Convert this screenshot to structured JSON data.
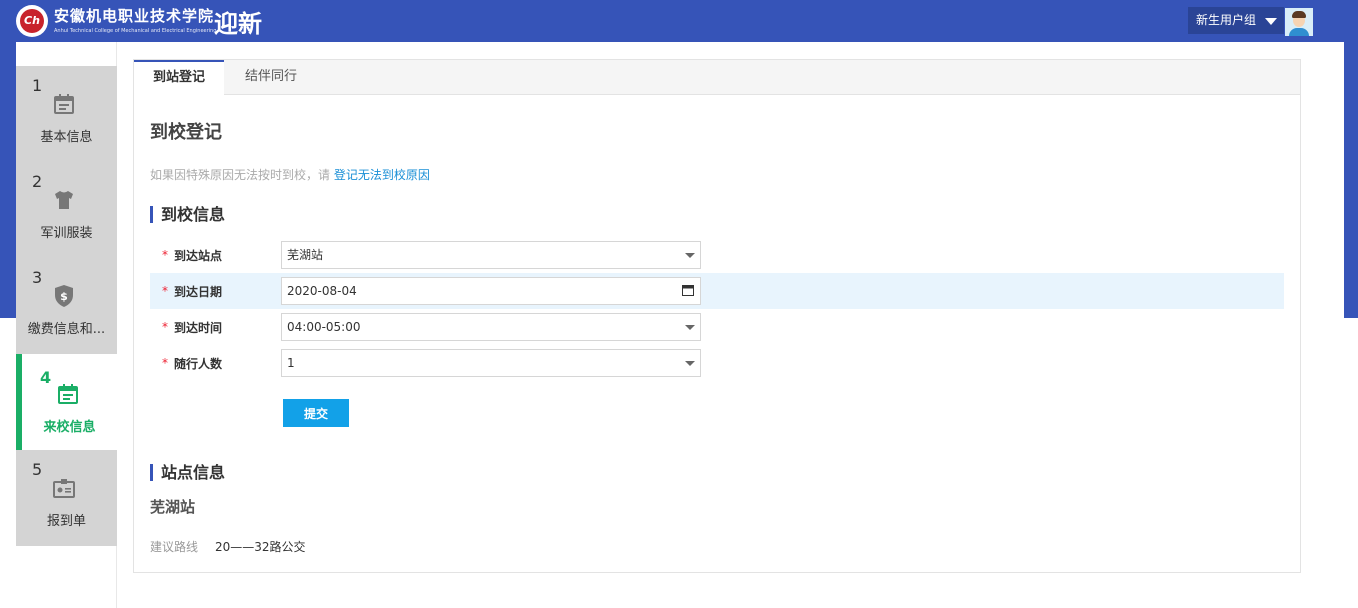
{
  "header": {
    "logo_text": "Ch",
    "school_name_cn": "安徽机电职业技术学院",
    "school_name_en": "Anhui Technical College of Mechanical and Electrical Engineering",
    "app_title": "迎新",
    "user_group": "新生用户组",
    "brand_color": "#3654b8"
  },
  "sidebar": {
    "steps": [
      {
        "num": "1",
        "label": "基本信息",
        "icon": "calendar-icon",
        "active": false
      },
      {
        "num": "2",
        "label": "军训服装",
        "icon": "tshirt-icon",
        "active": false
      },
      {
        "num": "3",
        "label": "缴费信息和...",
        "icon": "shield-dollar-icon",
        "active": false
      },
      {
        "num": "4",
        "label": "来校信息",
        "icon": "calendar-check-icon",
        "active": true
      },
      {
        "num": "5",
        "label": "报到单",
        "icon": "id-card-icon",
        "active": false
      }
    ],
    "active_color": "#1aae66"
  },
  "tabs": [
    {
      "label": "到站登记",
      "active": true
    },
    {
      "label": "结伴同行",
      "active": false
    }
  ],
  "main": {
    "title": "到校登记",
    "notice_prefix": "如果因特殊原因无法按时到校，请",
    "notice_link": "登记无法到校原因",
    "arrival_section": "到校信息",
    "station_section": "站点信息"
  },
  "form": {
    "station": {
      "label": "到达站点",
      "value": "芜湖站"
    },
    "date": {
      "label": "到达日期",
      "value": "2020-08-04"
    },
    "time": {
      "label": "到达时间",
      "value": "04:00-05:00"
    },
    "companions": {
      "label": "随行人数",
      "value": "1"
    },
    "required_mark": "*",
    "submit_label": "提交"
  },
  "station_info": {
    "name": "芜湖站",
    "route_label": "建议路线",
    "route_value": "20——32路公交"
  }
}
